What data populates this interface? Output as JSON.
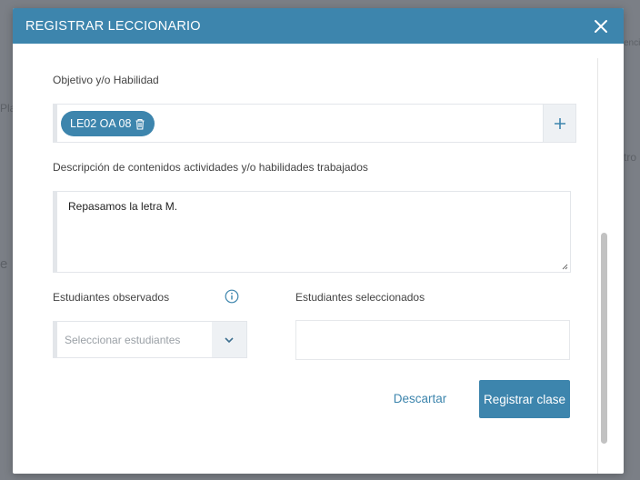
{
  "background": {
    "fragments": [
      "Pla",
      "encia",
      "tro",
      "e"
    ]
  },
  "modal": {
    "title": "REGISTRAR LECCIONARIO",
    "close_icon": "close-icon"
  },
  "form": {
    "objetivo_label": "Objetivo y/o Habilidad",
    "chip_label": "LE02 OA 08",
    "chip_icon": "trash-icon",
    "add_icon": "plus-icon",
    "descripcion_label": "Descripción de contenidos actividades y/o habilidades trabajados",
    "descripcion_value": "Repasamos la letra M.",
    "observados_label": "Estudiantes observados",
    "info_icon": "info-icon",
    "select_placeholder": "Seleccionar estudiantes",
    "select_icon": "chevron-down-icon",
    "seleccionados_label": "Estudiantes seleccionados"
  },
  "actions": {
    "cancel_label": "Descartar",
    "submit_label": "Registrar clase"
  },
  "colors": {
    "accent": "#3d85ad",
    "overlay": "#7b7f86"
  }
}
